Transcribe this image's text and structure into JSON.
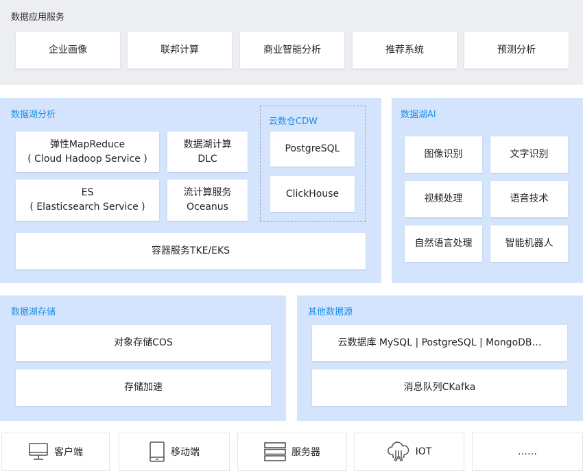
{
  "top": {
    "title": "数据应用服务",
    "items": [
      "企业画像",
      "联邦计算",
      "商业智能分析",
      "推荐系统",
      "预测分析"
    ]
  },
  "analysis": {
    "title": "数据湖分析",
    "emr": {
      "line1": "弹性MapReduce",
      "line2": "( Cloud Hadoop Service )"
    },
    "dlc": {
      "line1": "数据湖计算",
      "line2": "DLC"
    },
    "es": {
      "line1": "ES",
      "line2": "( Elasticsearch Service )"
    },
    "oceanus": {
      "line1": "流计算服务",
      "line2": "Oceanus"
    },
    "cdw": {
      "title": "云数仓CDW",
      "items": [
        "PostgreSQL",
        "ClickHouse"
      ]
    },
    "container": "容器服务TKE/EKS"
  },
  "ai": {
    "title": "数据湖AI",
    "items": [
      "图像识别",
      "文字识别",
      "视频处理",
      "语音技术",
      "自然语言处理",
      "智能机器人"
    ]
  },
  "storage": {
    "title": "数据湖存储",
    "items": [
      "对象存储COS",
      "存储加速"
    ]
  },
  "sources": {
    "title": "其他数据源",
    "items": [
      "云数据库 MySQL | PostgreSQL | MongoDB…",
      "消息队列CKafka"
    ]
  },
  "bottom": [
    {
      "label": "客户端",
      "icon": "monitor-icon"
    },
    {
      "label": "移动端",
      "icon": "tablet-icon"
    },
    {
      "label": "服务器",
      "icon": "server-icon"
    },
    {
      "label": "IOT",
      "icon": "cloud-iot-icon"
    },
    {
      "label": "……",
      "icon": ""
    }
  ],
  "colors": {
    "accent_text": "#1e8fea",
    "blue_panel": "#d4e4fc",
    "gray_panel": "#eceef2"
  }
}
